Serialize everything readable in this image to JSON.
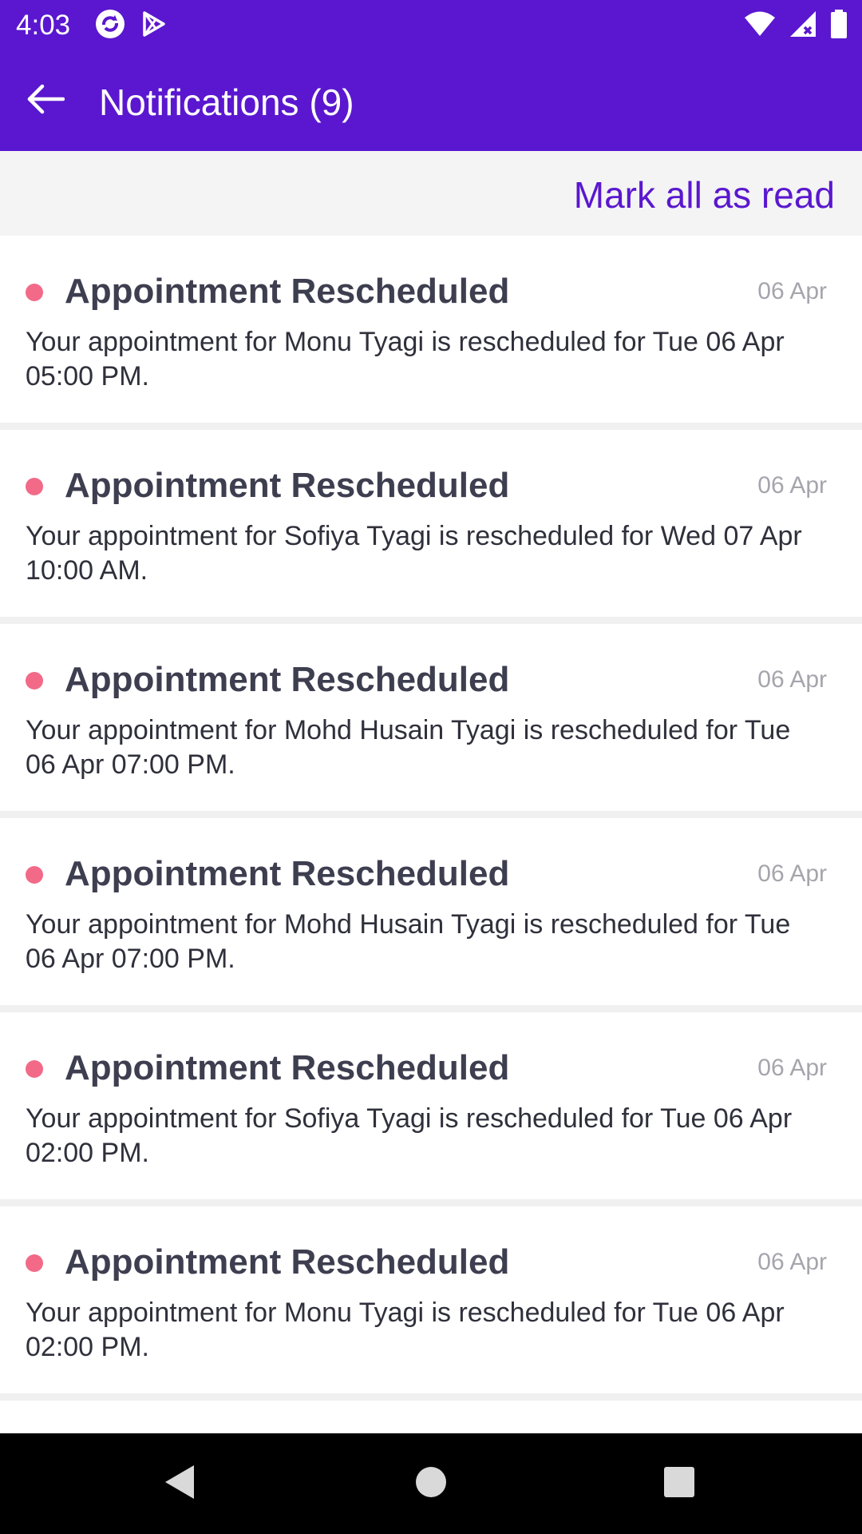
{
  "status_bar": {
    "time": "4:03",
    "app_icons": [
      "sync-app-icon",
      "play-store-icon"
    ],
    "system_icons": [
      "wifi-icon",
      "cell-signal-icon",
      "battery-icon"
    ]
  },
  "app_bar": {
    "back_icon": "back-arrow-icon",
    "title": "Notifications (9)"
  },
  "subbar": {
    "mark_all_label": "Mark all as read"
  },
  "notifications": [
    {
      "title": "Appointment Rescheduled",
      "date": "06 Apr",
      "body": "Your appointment for Monu Tyagi is rescheduled for Tue 06 Apr 05:00 PM.",
      "unread": true
    },
    {
      "title": "Appointment Rescheduled",
      "date": "06 Apr",
      "body": "Your appointment for Sofiya Tyagi is rescheduled for Wed 07 Apr 10:00 AM.",
      "unread": true
    },
    {
      "title": "Appointment Rescheduled",
      "date": "06 Apr",
      "body": "Your appointment for Mohd Husain Tyagi is rescheduled for Tue 06 Apr 07:00 PM.",
      "unread": true
    },
    {
      "title": "Appointment Rescheduled",
      "date": "06 Apr",
      "body": "Your appointment for Mohd Husain Tyagi is rescheduled for Tue 06 Apr 07:00 PM.",
      "unread": true
    },
    {
      "title": "Appointment Rescheduled",
      "date": "06 Apr",
      "body": "Your appointment for Sofiya Tyagi is rescheduled for Tue 06 Apr 02:00 PM.",
      "unread": true
    },
    {
      "title": "Appointment Rescheduled",
      "date": "06 Apr",
      "body": "Your appointment for Monu Tyagi is rescheduled for Tue 06 Apr 02:00 PM.",
      "unread": true
    }
  ],
  "nav_bar": {
    "buttons": [
      "back-nav-icon",
      "home-nav-icon",
      "recents-nav-icon"
    ]
  },
  "colors": {
    "primary": "#5a17cf",
    "unread_dot": "#f26a88",
    "date_text": "#a5a5ad"
  }
}
